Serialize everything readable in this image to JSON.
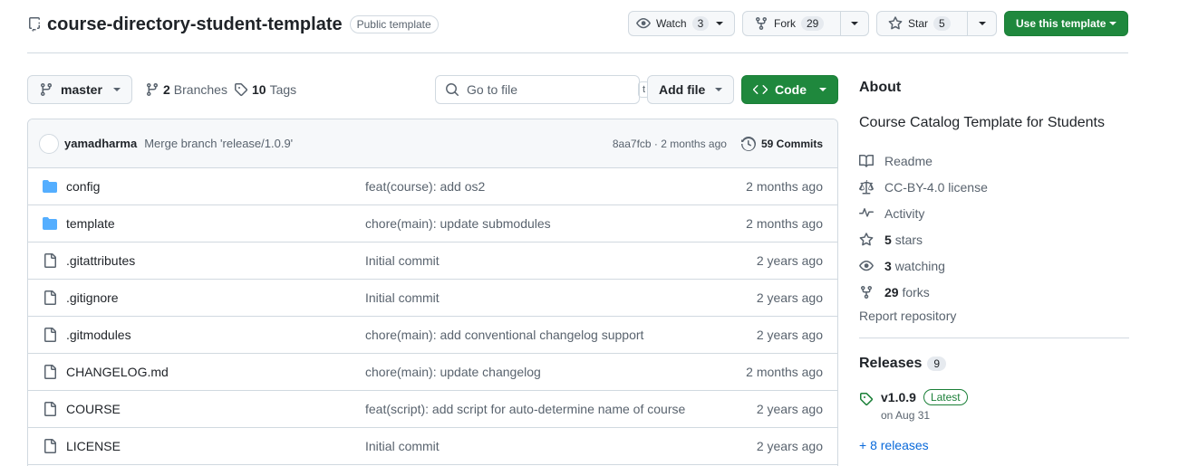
{
  "repo": {
    "name": "course-directory-student-template",
    "visibility": "Public template"
  },
  "header_actions": {
    "watch_label": "Watch",
    "watch_count": "3",
    "fork_label": "Fork",
    "fork_count": "29",
    "star_label": "Star",
    "star_count": "5",
    "use_template_label": "Use this template"
  },
  "toolbar": {
    "branch": "master",
    "branches_count": "2",
    "branches_label": "Branches",
    "tags_count": "10",
    "tags_label": "Tags",
    "search_placeholder": "Go to file",
    "search_shortcut": "t",
    "add_file_label": "Add file",
    "code_label": "Code"
  },
  "latest_commit": {
    "author": "yamadharma",
    "message": "Merge branch 'release/1.0.9'",
    "hash_time": "8aa7fcb · 2 months ago",
    "commits_label": "59 Commits"
  },
  "files": [
    {
      "type": "dir",
      "name": "config",
      "commit": "feat(course): add os2",
      "time": "2 months ago"
    },
    {
      "type": "dir",
      "name": "template",
      "commit": "chore(main): update submodules",
      "time": "2 months ago"
    },
    {
      "type": "file",
      "name": ".gitattributes",
      "commit": "Initial commit",
      "time": "2 years ago"
    },
    {
      "type": "file",
      "name": ".gitignore",
      "commit": "Initial commit",
      "time": "2 years ago"
    },
    {
      "type": "file",
      "name": ".gitmodules",
      "commit": "chore(main): add conventional changelog support",
      "time": "2 years ago"
    },
    {
      "type": "file",
      "name": "CHANGELOG.md",
      "commit": "chore(main): update changelog",
      "time": "2 months ago"
    },
    {
      "type": "file",
      "name": "COURSE",
      "commit": "feat(script): add script for auto-determine name of course",
      "time": "2 years ago"
    },
    {
      "type": "file",
      "name": "LICENSE",
      "commit": "Initial commit",
      "time": "2 years ago"
    }
  ],
  "about": {
    "title": "About",
    "description": "Course Catalog Template for Students",
    "readme": "Readme",
    "license": "CC-BY-4.0 license",
    "activity": "Activity",
    "stars_count": "5",
    "stars_label": "stars",
    "watching_count": "3",
    "watching_label": "watching",
    "forks_count": "29",
    "forks_label": "forks",
    "report": "Report repository"
  },
  "releases": {
    "title": "Releases",
    "count": "9",
    "latest_version": "v1.0.9",
    "latest_badge": "Latest",
    "latest_date": "on Aug 31",
    "more_label": "+ 8 releases"
  },
  "colors": {
    "green": "#1f883d",
    "link_blue": "#0969da",
    "folder_blue": "#54aeff",
    "muted": "#59636e"
  }
}
